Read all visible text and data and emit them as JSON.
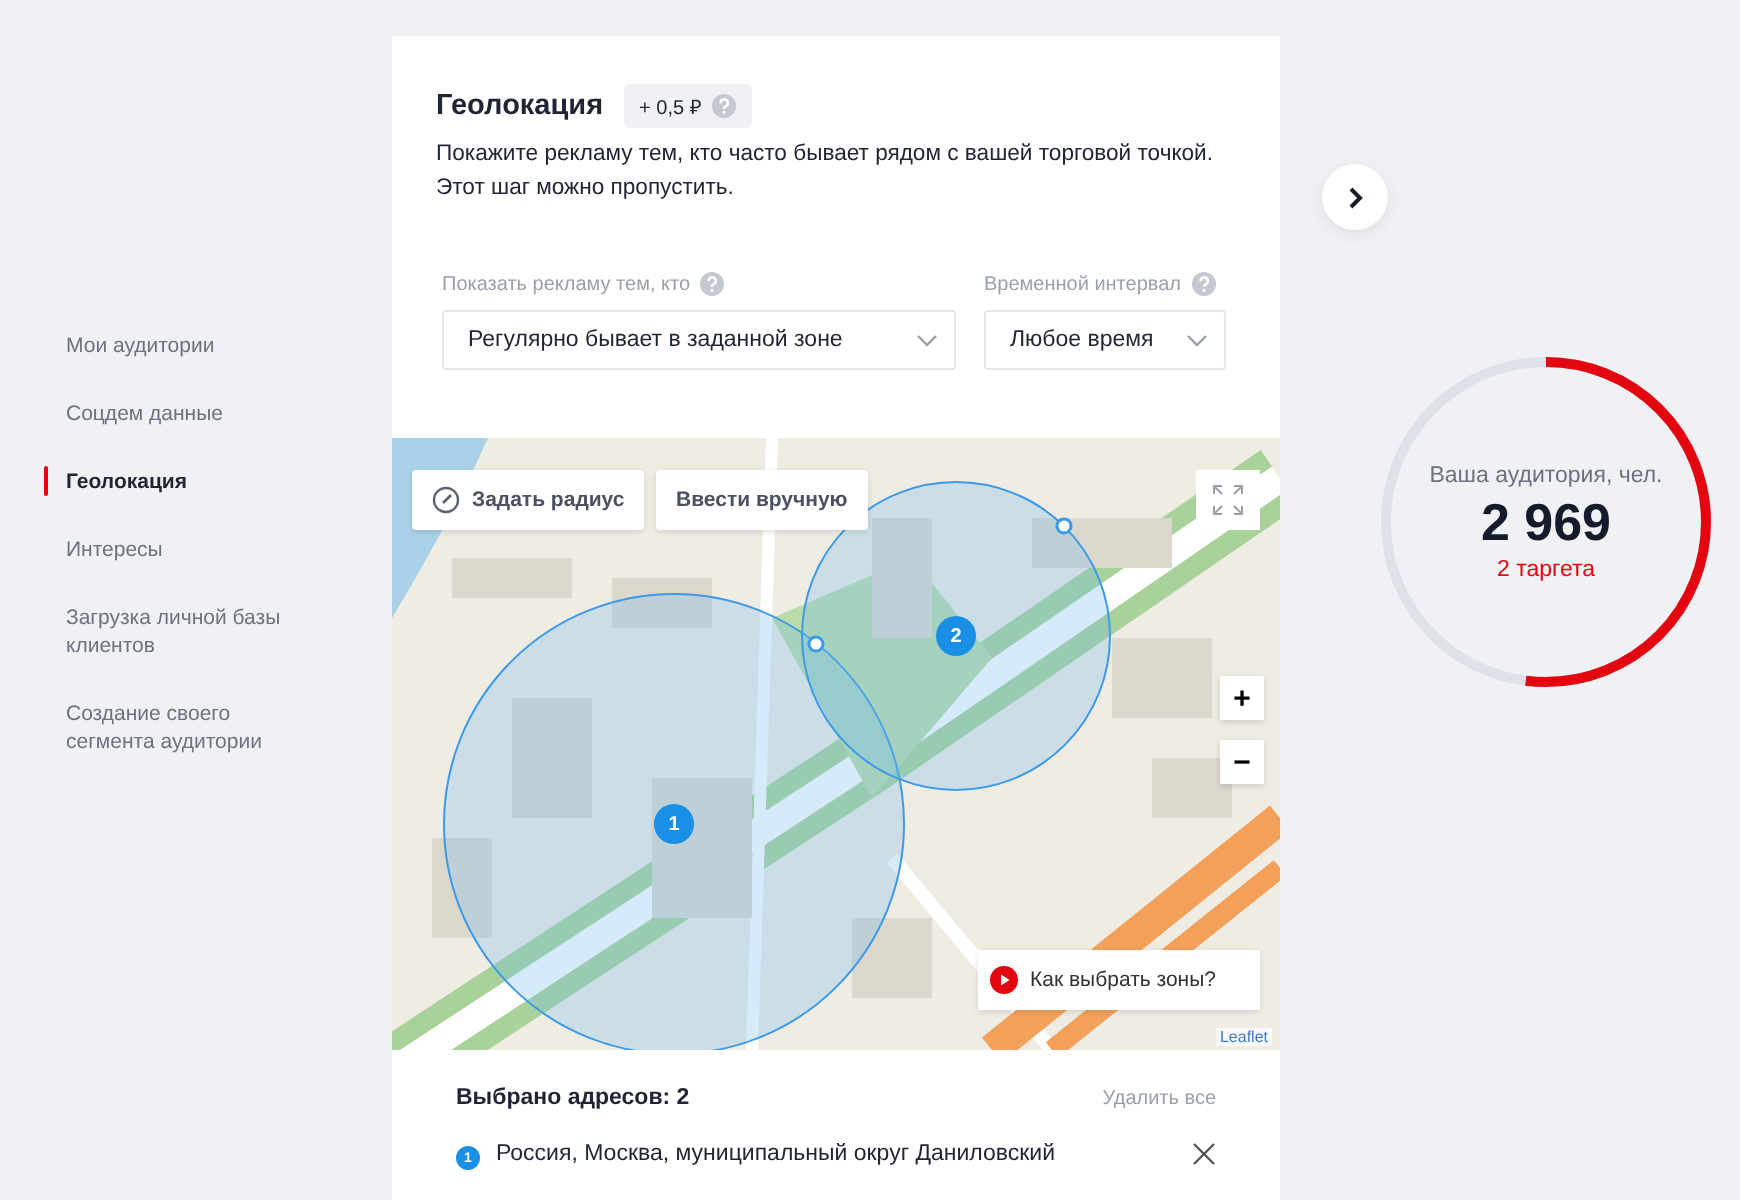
{
  "sidebar": {
    "items": [
      {
        "label": "Мои аудитории",
        "selected": false
      },
      {
        "label": "Соцдем данные",
        "selected": false
      },
      {
        "label": "Геолокация",
        "selected": true
      },
      {
        "label": "Интересы",
        "selected": false
      },
      {
        "label": "Загрузка личной базы клиентов",
        "selected": false
      },
      {
        "label": "Создание своего сегмента аудитории",
        "selected": false
      }
    ]
  },
  "section": {
    "title": "Геолокация",
    "price_badge": "+ 0,5 ₽",
    "description": "Покажите рекламу тем, кто часто бывает рядом с вашей торговой точкой. Этот шаг можно пропустить.",
    "filters": [
      {
        "label": "Показать рекламу тем, кто",
        "value": "Регулярно бывает в заданной зоне"
      },
      {
        "label": "Временной интервал",
        "value": "Любое время"
      }
    ]
  },
  "map": {
    "buttons": [
      {
        "kind": "radius",
        "label": "Задать радиус"
      },
      {
        "kind": "plain",
        "label": "Ввести вручную"
      }
    ],
    "zones": [
      {
        "number": "1"
      },
      {
        "number": "2"
      }
    ],
    "zoom_in": "+",
    "zoom_out": "−",
    "help_link": "Как выбрать зоны?",
    "attribution": "Leaflet"
  },
  "addresses": {
    "title": "Выбрано адресов: 2",
    "clear_all": "Удалить все",
    "items": [
      {
        "number": "1",
        "text": "Россия, Москва, муниципальный округ Даниловский"
      }
    ]
  },
  "audience": {
    "label": "Ваша аудитория, чел.",
    "count": "2 969",
    "targets": "2 таргета",
    "level": 0.52
  }
}
